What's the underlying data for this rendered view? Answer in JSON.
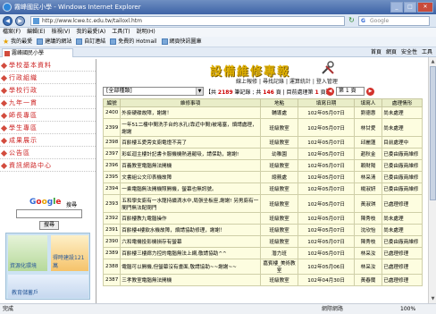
{
  "window": {
    "title": "霧峰國民小學 - Windows Internet Explorer"
  },
  "address": {
    "url": "http://www.lcwe.tc.edu.tw/tailoxl.htm",
    "search_placeholder": "Google"
  },
  "menu": [
    "檔案(F)",
    "編輯(E)",
    "檢視(V)",
    "我的最愛(A)",
    "工具(T)",
    "說明(H)"
  ],
  "favorites": {
    "label": "我的最愛",
    "items": [
      "建議的網站",
      "自訂連結",
      "免費的 Hotmail",
      "網頁快訊圖庫"
    ]
  },
  "tab": {
    "label": "霧峰國民小學"
  },
  "tools": [
    "首頁",
    "網頁",
    "安全性",
    "工具"
  ],
  "sidebar": {
    "items": [
      "學校基本資料",
      "行政組織",
      "學校行政",
      "九年一貫",
      "師長專區",
      "學生專區",
      "成果展示",
      "公告區",
      "資訊網路中心"
    ],
    "google_label": "搜尋",
    "google_button": "搜尋",
    "banner1": "資源化環境",
    "banner2": "得時建設121萬",
    "banner3": "教育儲蓄戶"
  },
  "forum": {
    "title": "設備維修專報",
    "links": [
      "線上報修",
      "尋找記錄",
      "運算統計",
      "登入管理"
    ],
    "category": "[全部種類]",
    "stats_prefix": "【共 ",
    "total": "2189",
    "stats_mid": " 筆記錄 ; 共 ",
    "pages": "146",
    "stats_mid2": " 頁 | 目前處理第 ",
    "current": "1",
    "stats_end": " 頁】",
    "page_select": "第 1 頁"
  },
  "columns": [
    "編號",
    "維修事項",
    "地點",
    "填寫日期",
    "填寫人",
    "處理情形"
  ],
  "rows": [
    {
      "num": "2400",
      "subject": "外掛硬碟故障，謝謝！",
      "place": "輔導處",
      "date": "102年05月07日",
      "user": "劉德惠",
      "status": "尚未處理"
    },
    {
      "num": "2399",
      "subject": "一年51二樓中間洗手台的水孔(靠近中間)被堵塞，煩請處理，謝謝",
      "place": "班級教室",
      "date": "102年05月07日",
      "user": "林甘愛",
      "status": "尚未處理"
    },
    {
      "num": "2398",
      "subject": "百齡樓五愛旁女廁電燈不亮了",
      "place": "班級教室",
      "date": "102年05月07日",
      "user": "邱麗蓮",
      "status": "目前處理中"
    },
    {
      "num": "2397",
      "subject": "彩虹迴主樓計記書卡服機機熱過罷吸，請保助，謝謝!",
      "place": "幼稚園",
      "date": "102年05月07日",
      "user": "趙秋金",
      "status": "已委由廠商維修"
    },
    {
      "num": "2396",
      "subject": "百義教室電腦無法開機",
      "place": "班級教室",
      "date": "102年05月07日",
      "user": "賴財陽",
      "status": "已委由廠商維修"
    },
    {
      "num": "2395",
      "subject": "文書組公文印表機故障",
      "place": "總務處",
      "date": "102年05月07日",
      "user": "林采清",
      "status": "已委由廠商維修"
    },
    {
      "num": "2394",
      "subject": "一乘電腦無法開機照開機，螢幕也無訊號。",
      "place": "班級教室",
      "date": "102年05月07日",
      "user": "楊淑妍",
      "status": "已委由廠商維修"
    },
    {
      "num": "2393",
      "subject": "五和學女廁有一水龍持續滴水中,局張坐板座,謝謝! 另男廁有一間門無法配閉門",
      "place": "班級教室",
      "date": "102年05月07日",
      "user": "黃淑琪",
      "status": "已處理修理"
    },
    {
      "num": "2392",
      "subject": "百齡樓教九電腦操作",
      "place": "班級教室",
      "date": "102年05月07日",
      "user": "陳秀枝",
      "status": "尚未處理"
    },
    {
      "num": "2391",
      "subject": "百齡樓4樓飲水機故障，煩請協助修理，謝謝！",
      "place": "班級教室",
      "date": "102年05月07日",
      "user": "沈欣怡",
      "status": "尚未處理"
    },
    {
      "num": "2390",
      "subject": "六和電機投影機損存有螢幕",
      "place": "班級教室",
      "date": "102年05月07日",
      "user": "陳秀枝",
      "status": "已委由廠商維修"
    },
    {
      "num": "2389",
      "subject": "百齡樓三樓廊力控的電腦無法上網,敬請協助^^",
      "place": "潛力班",
      "date": "102年05月07日",
      "user": "林采汝",
      "status": "已處理修理"
    },
    {
      "num": "2388",
      "subject": "電腦可以開機,但螢幕沒有畫面,敬請協助~~謝謝~~",
      "place": "嘉賓樓_美術教室",
      "date": "102年05月06日",
      "user": "林采汝",
      "status": "已處理修理"
    },
    {
      "num": "2387",
      "subject": "三孝教室電腦無法開機",
      "place": "班級教室",
      "date": "102年04月30日",
      "user": "黃春蘭",
      "status": "已處理修理"
    }
  ],
  "status": {
    "done": "完成",
    "zone": "網際網路",
    "zoom": "100%"
  }
}
